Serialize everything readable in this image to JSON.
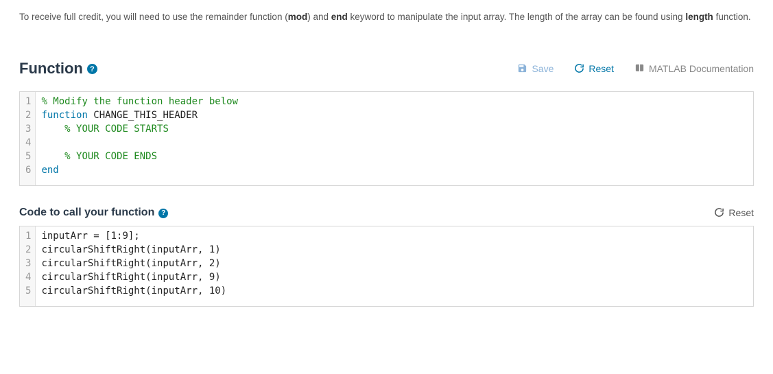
{
  "instructions": {
    "pre": "To receive full credit, you will need to use the remainder function (",
    "kw1": "mod",
    "mid1": ") and ",
    "kw2": "end",
    "mid2": " keyword to manipulate the input array. The length of the array can be found using ",
    "kw3": "length",
    "post": " function."
  },
  "section1": {
    "title": "Function",
    "actions": {
      "save": "Save",
      "reset": "Reset",
      "docs": "MATLAB Documentation"
    }
  },
  "editor1": {
    "line_numbers": [
      "1",
      "2",
      "3",
      "4",
      "5",
      "6"
    ],
    "l1": "% Modify the function header below",
    "l2a": "function",
    "l2b": " CHANGE_THIS_HEADER",
    "l3": "    % YOUR CODE STARTS",
    "l4": "    ",
    "l5": "    % YOUR CODE ENDS",
    "l6": "end"
  },
  "section2": {
    "title": "Code to call your function",
    "reset": "Reset"
  },
  "editor2": {
    "line_numbers": [
      "1",
      "2",
      "3",
      "4",
      "5"
    ],
    "l1": "inputArr = [1:9];",
    "l2": "circularShiftRight(inputArr, 1)",
    "l3": "circularShiftRight(inputArr, 2)",
    "l4": "circularShiftRight(inputArr, 9)",
    "l5": "circularShiftRight(inputArr, 10)"
  }
}
